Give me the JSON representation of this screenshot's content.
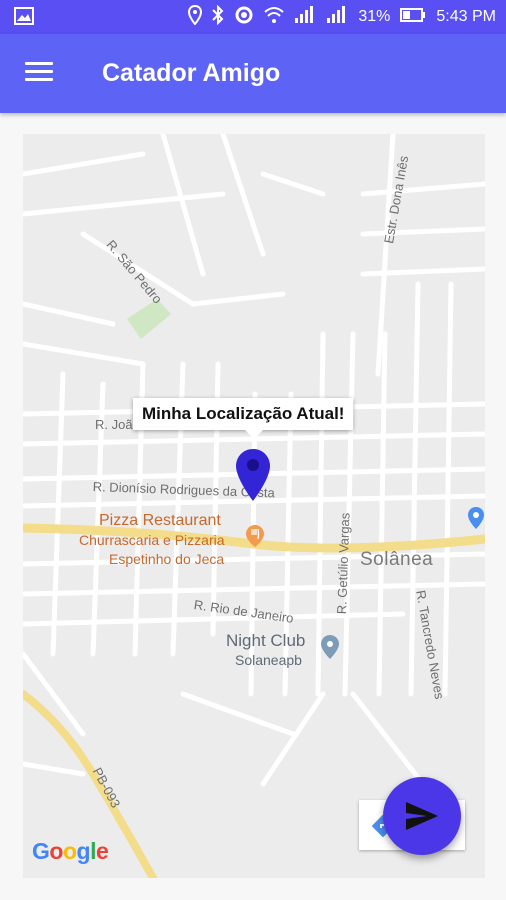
{
  "status_bar": {
    "battery": "31%",
    "time": "5:43 PM"
  },
  "app_bar": {
    "title": "Catador Amigo",
    "menu_icon": "hamburger-menu-icon"
  },
  "map": {
    "info_window": "Minha Localização Atual!",
    "streets": {
      "sao_pedro": "R. São Pedro",
      "dona_ines": "Estr. Dona Inês",
      "joao_fausto": "R. João Fausto Pinto",
      "dionisio": "R. Dionísio Rodrigues da Costa",
      "getulio": "R. Getúlio Vargas",
      "tancredo": "R. Tancredo Neves",
      "rio_janeiro": "R. Rio de Janeiro",
      "pb093": "PB-093"
    },
    "pois": {
      "pizza": "Pizza Restaurant",
      "churrascaria_line1": "Churrascaria e Pizzaria",
      "churrascaria_line2": "Espetinho do Jeca",
      "night_club": "Night Club",
      "night_club_sub": "Solaneapb"
    },
    "city": "Solânea",
    "attribution": "Google"
  },
  "fab": {
    "icon": "send-icon"
  },
  "colors": {
    "status_bar": "#5a4ff2",
    "app_bar": "#5c63f5",
    "fab": "#4b37e7",
    "marker": "#3325d6"
  }
}
